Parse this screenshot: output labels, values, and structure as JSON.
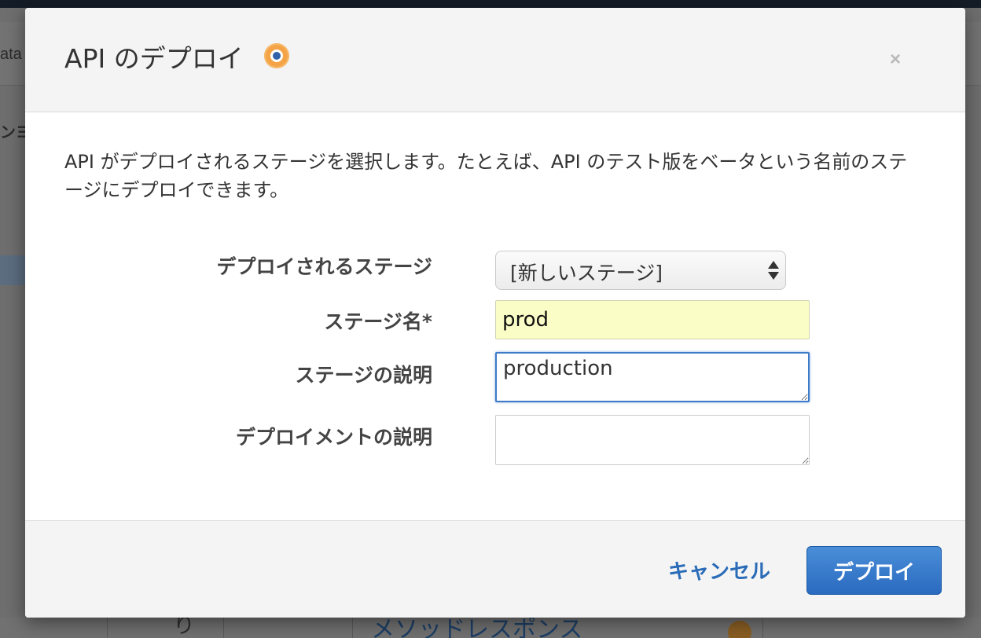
{
  "background": {
    "left_text_top": "ata",
    "left_text_mid": "ンヨ",
    "bottom_link": "メソッドレスポンス",
    "bottom_glyph": "り"
  },
  "modal": {
    "title": "API のデプロイ",
    "info_icon": "info-icon",
    "close_symbol": "×",
    "description": "API がデプロイされるステージを選択します。たとえば、API のテスト版をベータという名前のステージにデプロイできます。",
    "form": {
      "stage_label": "デプロイされるステージ",
      "stage_value": "[新しいステージ]",
      "stage_name_label": "ステージ名*",
      "stage_name_value": "prod",
      "stage_desc_label": "ステージの説明",
      "stage_desc_value": "production",
      "deploy_desc_label": "デプロイメントの説明",
      "deploy_desc_value": ""
    },
    "footer": {
      "cancel_label": "キャンセル",
      "deploy_label": "デプロイ"
    }
  },
  "colors": {
    "accent": "#2a6ac0",
    "link": "#2a6bb8",
    "highlight_input": "#fbfdc6",
    "info_icon": "#f4a447"
  }
}
